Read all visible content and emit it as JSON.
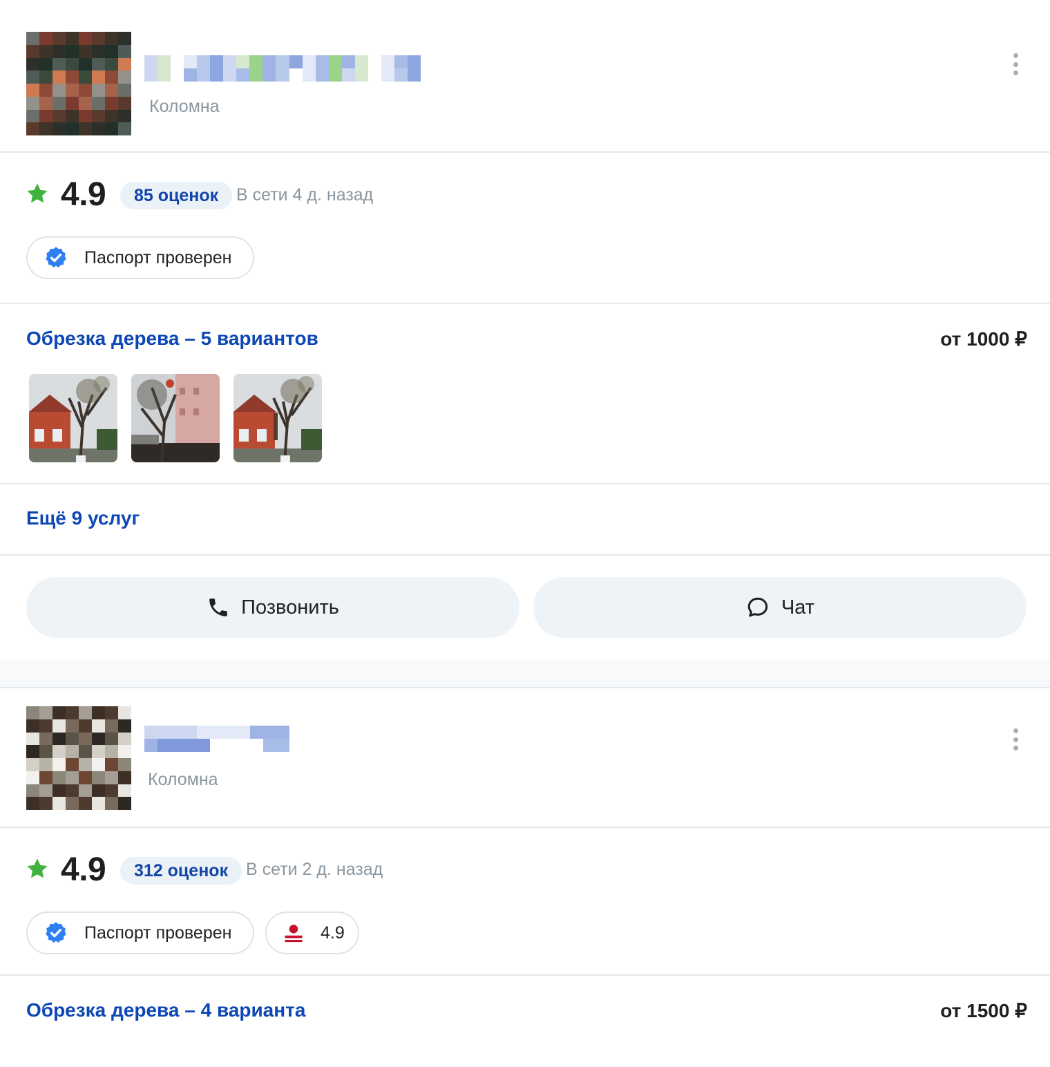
{
  "listings": [
    {
      "city": "Коломна",
      "rating": "4.9",
      "reviews": "85 оценок",
      "online": "В сети 4 д. назад",
      "badges": {
        "passport": "Паспорт проверен"
      },
      "service": {
        "title": "Обрезка дерева – 5 вариантов",
        "price": "от 1000 ₽"
      },
      "more_services": "Ещё 9 услуг",
      "actions": {
        "call": "Позвонить",
        "chat": "Чат"
      }
    },
    {
      "city": "Коломна",
      "rating": "4.9",
      "reviews": "312 оценок",
      "online": "В сети 2 д. назад",
      "badges": {
        "passport": "Паспорт проверен",
        "other_rating": "4.9"
      },
      "service": {
        "title": "Обрезка дерева – 4 варианта",
        "price": "от 1500 ₽"
      }
    }
  ],
  "icons": {
    "rating": "star-icon",
    "passport": "verified-check-icon",
    "other_rating": "person-icon",
    "more": "kebab-menu-icon",
    "call": "phone-icon",
    "chat": "chat-bubble-icon"
  },
  "colors": {
    "link": "#0d47b5",
    "star": "#3fb33e",
    "verified": "#2d7ff2",
    "pill_bg": "#eaf1f7",
    "button_bg": "#eef3f8",
    "divider": "#e3e9ee"
  }
}
